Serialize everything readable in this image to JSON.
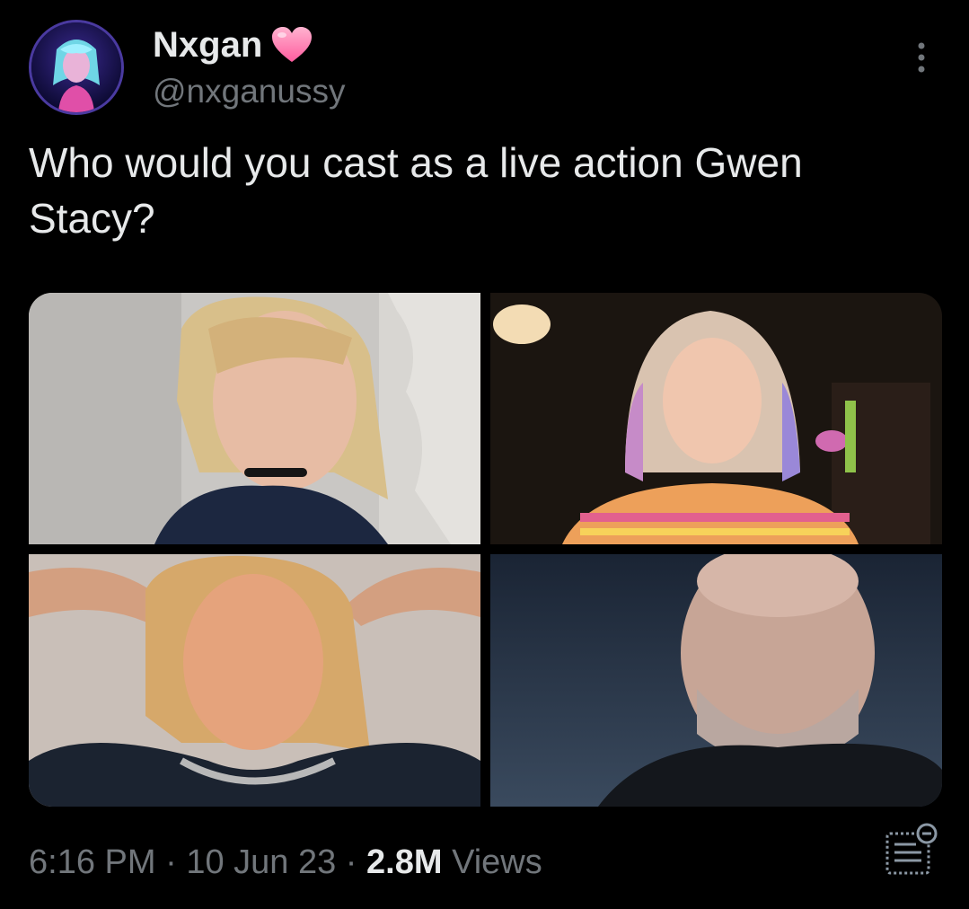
{
  "author": {
    "display_name": "Nxgan",
    "handle": "@nxganussy",
    "verified_icon": "pink-heart-icon"
  },
  "tweet": {
    "text": "Who would you cast as a live action Gwen Stacy?",
    "time": "6:16 PM",
    "date": "10 Jun 23",
    "separator": "·",
    "views_count": "2.8M",
    "views_label": "Views"
  },
  "icons": {
    "more": "more-options-icon",
    "analytics": "analytics-icon"
  },
  "colors": {
    "background": "#000000",
    "text_primary": "#e7e9ea",
    "text_secondary": "#71767b",
    "heart": "#ff6aa6"
  }
}
